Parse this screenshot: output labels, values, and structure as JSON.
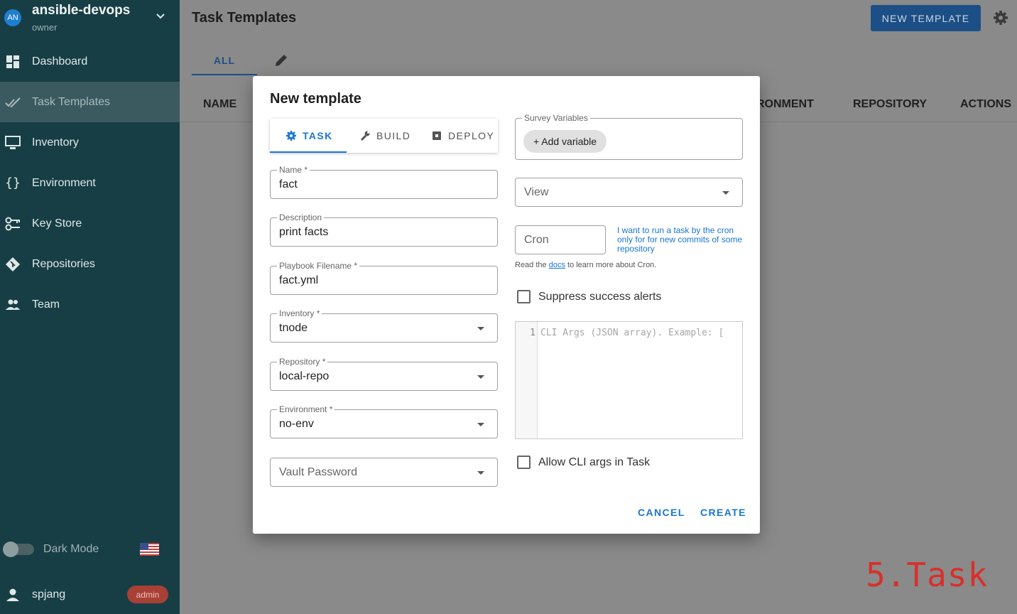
{
  "sidebar": {
    "project": {
      "avatar": "AN",
      "name": "ansible-devops",
      "role": "owner"
    },
    "items": [
      {
        "label": "Dashboard",
        "icon": "dashboard-icon"
      },
      {
        "label": "Task Templates",
        "icon": "task-templates-icon",
        "active": true
      },
      {
        "label": "Inventory",
        "icon": "inventory-icon"
      },
      {
        "label": "Environment",
        "icon": "environment-icon"
      },
      {
        "label": "Key Store",
        "icon": "key-store-icon"
      },
      {
        "label": "Repositories",
        "icon": "repositories-icon"
      },
      {
        "label": "Team",
        "icon": "team-icon"
      }
    ],
    "dark_mode_label": "Dark Mode",
    "user": {
      "name": "spjang",
      "badge": "admin"
    }
  },
  "main": {
    "title": "Task Templates",
    "new_button": "NEW TEMPLATE",
    "tabs": {
      "all": "ALL"
    },
    "columns": [
      "NAME",
      "RONMENT",
      "REPOSITORY",
      "ACTIONS"
    ]
  },
  "dialog": {
    "title": "New template",
    "tabs": [
      "TASK",
      "BUILD",
      "DEPLOY"
    ],
    "fields": {
      "name": {
        "label": "Name *",
        "value": "fact"
      },
      "description": {
        "label": "Description",
        "value": "print facts"
      },
      "playbook": {
        "label": "Playbook Filename *",
        "value": "fact.yml"
      },
      "inventory": {
        "label": "Inventory *",
        "value": "tnode"
      },
      "repository": {
        "label": "Repository *",
        "value": "local-repo"
      },
      "environment": {
        "label": "Environment *",
        "value": "no-env"
      },
      "vault": {
        "placeholder": "Vault Password"
      }
    },
    "survey": {
      "label": "Survey Variables",
      "add_button": "+ Add variable"
    },
    "view": {
      "placeholder": "View"
    },
    "cron": {
      "placeholder": "Cron",
      "hint": "I want to run a task by the cron only for for new commits of some repository",
      "doc_prefix": "Read the ",
      "doc_link": "docs",
      "doc_suffix": " to learn more about Cron."
    },
    "suppress_label": "Suppress success alerts",
    "editor": {
      "line_number": "1",
      "placeholder": "CLI Args (JSON array). Example: ["
    },
    "allow_cli_label": "Allow CLI args in Task",
    "cancel": "CANCEL",
    "create": "CREATE"
  },
  "overlay_text": "5.Task",
  "colors": {
    "sidebar": "#173e45",
    "accent": "#1976d2",
    "watermark": "#d8302a"
  }
}
